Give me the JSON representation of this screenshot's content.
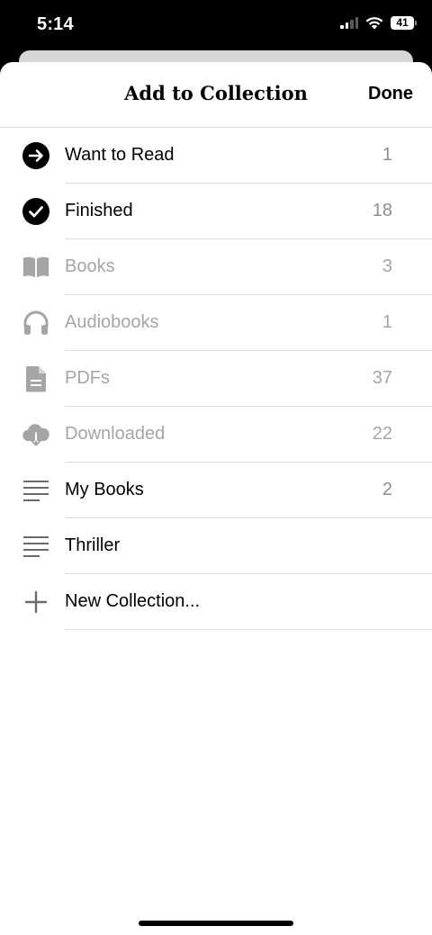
{
  "status_bar": {
    "time": "5:14",
    "battery": "41"
  },
  "header": {
    "title": "Add to Collection",
    "done_label": "Done"
  },
  "collections": [
    {
      "label": "Want to Read",
      "count": "1",
      "icon": "arrow-right-circle-icon"
    },
    {
      "label": "Finished",
      "count": "18",
      "icon": "checkmark-circle-icon"
    },
    {
      "label": "Books",
      "count": "3",
      "icon": "book-icon"
    },
    {
      "label": "Audiobooks",
      "count": "1",
      "icon": "headphones-icon"
    },
    {
      "label": "PDFs",
      "count": "37",
      "icon": "document-icon"
    },
    {
      "label": "Downloaded",
      "count": "22",
      "icon": "cloud-download-icon"
    },
    {
      "label": "My Books",
      "count": "2",
      "icon": "list-icon"
    },
    {
      "label": "Thriller",
      "count": "",
      "icon": "list-icon"
    },
    {
      "label": "New Collection...",
      "count": "",
      "icon": "plus-icon"
    }
  ],
  "colors": {
    "primary_text": "#000000",
    "disabled_text": "#a5a5a5",
    "count_text": "#8e8e8e",
    "separator": "#dedede"
  }
}
